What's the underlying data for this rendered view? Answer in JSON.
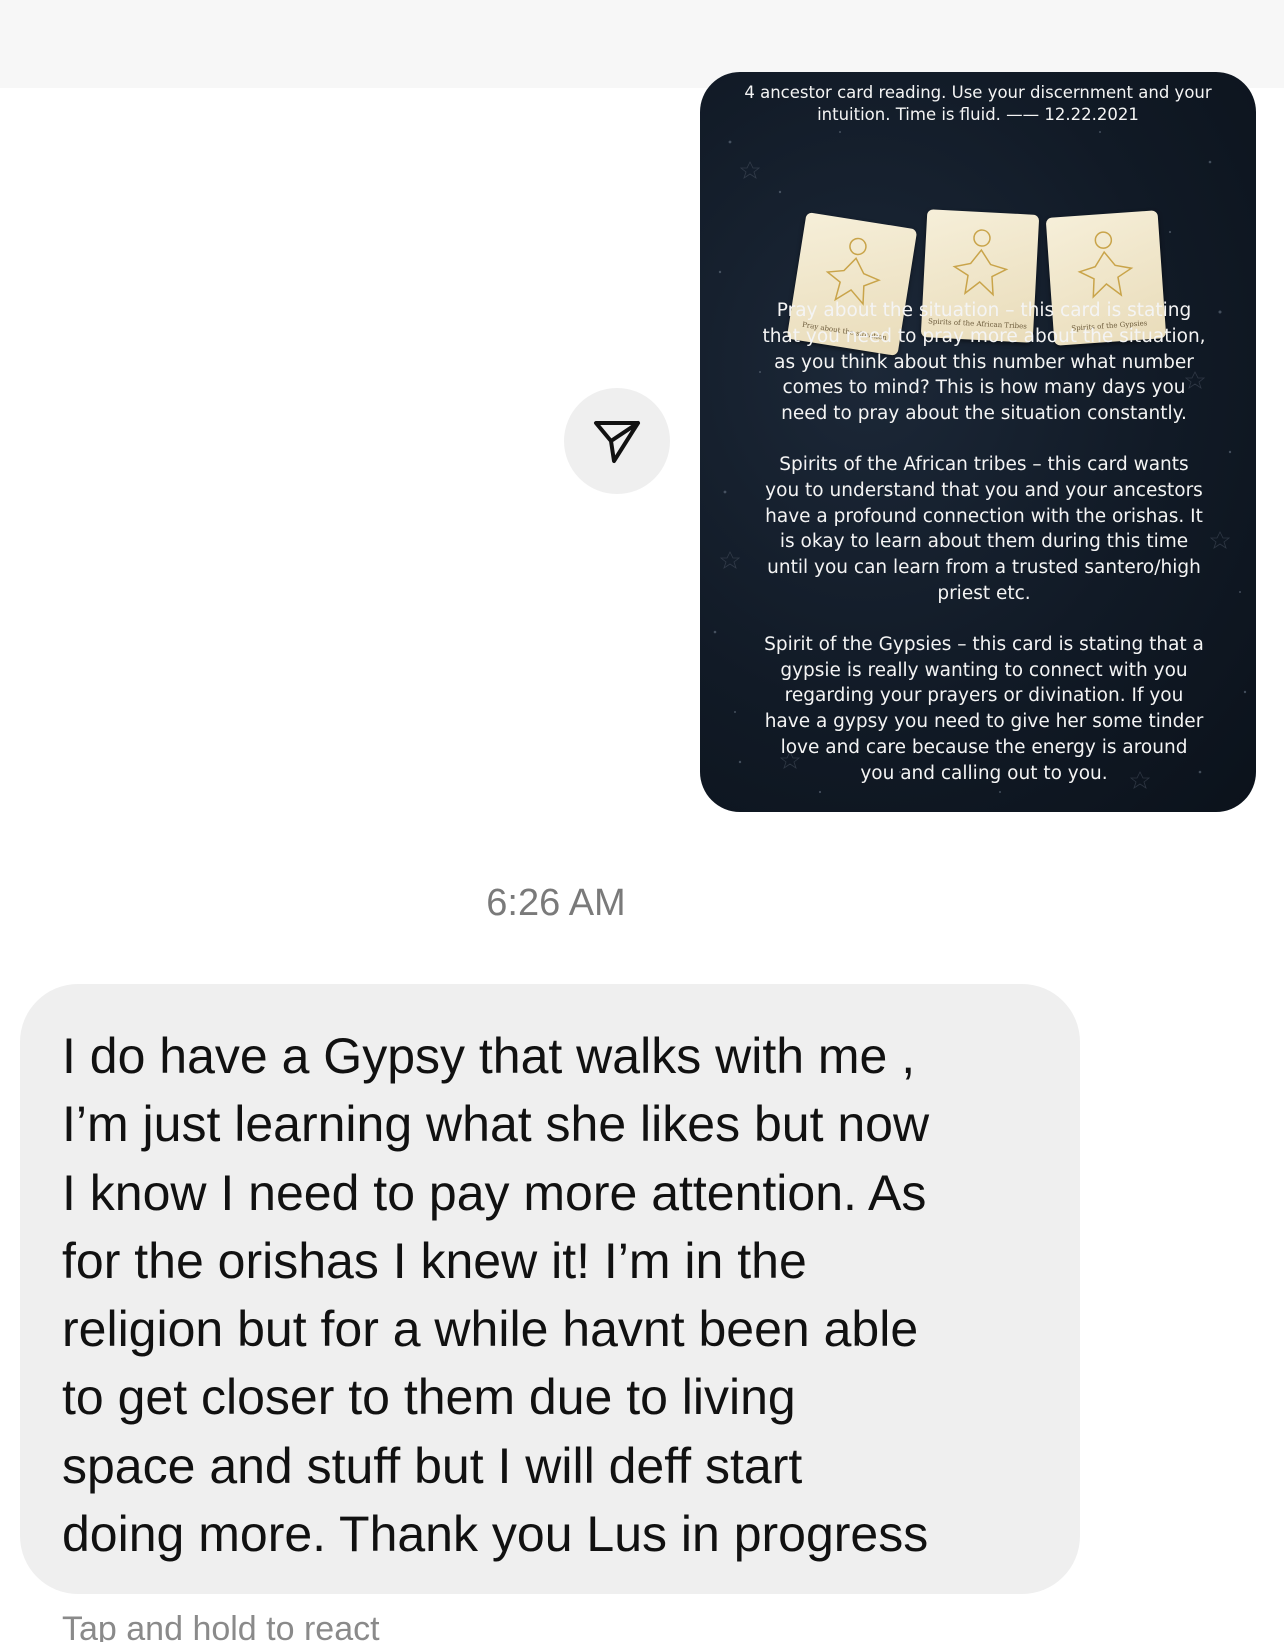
{
  "shared_post": {
    "header_line1": "4 ancestor card reading. Use your discernment and your",
    "header_line2": "intuition. Time is fluid. —— 12.22.2021",
    "cards": [
      {
        "caption": "Pray about the situation"
      },
      {
        "caption": "Spirits of the African Tribes"
      },
      {
        "caption": "Spirits of the Gypsies"
      }
    ],
    "paragraphs": [
      "Pray about the situation – this card is stating\nthat you need to pray more about the situation,\nas you think about this number what number\ncomes to mind? This is how many days  you\nneed to pray about the situation constantly.",
      "Spirits of the African tribes – this card wants\nyou to understand that you and your ancestors\nhave a profound connection with the orishas.  It\nis okay to learn about them during this time\nuntil you can learn from a trusted santero/high\npriest etc.",
      "Spirit of the Gypsies – this card is stating that a\ngypsie is really wanting to connect with you\nregarding your prayers or divination. If you\nhave a gypsy you need to give her some tinder\nlove and care because the energy is around\nyou and calling out to you."
    ]
  },
  "share_button": {
    "icon": "paper-plane-icon"
  },
  "timestamp": "6:26 AM",
  "message": {
    "text": "I do have a Gypsy that walks with me ,\nI’m just learning what she likes but now\nI know I need to pay more attention. As\nfor the orishas I knew it! I’m in the\nreligion but for a while havnt been able\nto get closer to them due to living\nspace and stuff but I will deff start\ndoing more. Thank you Lus in progress"
  },
  "react_hint": "Tap and hold to react",
  "colors": {
    "bubble": "#efefef",
    "post_background": "#111a26",
    "timestamp": "#7a7a7a"
  }
}
